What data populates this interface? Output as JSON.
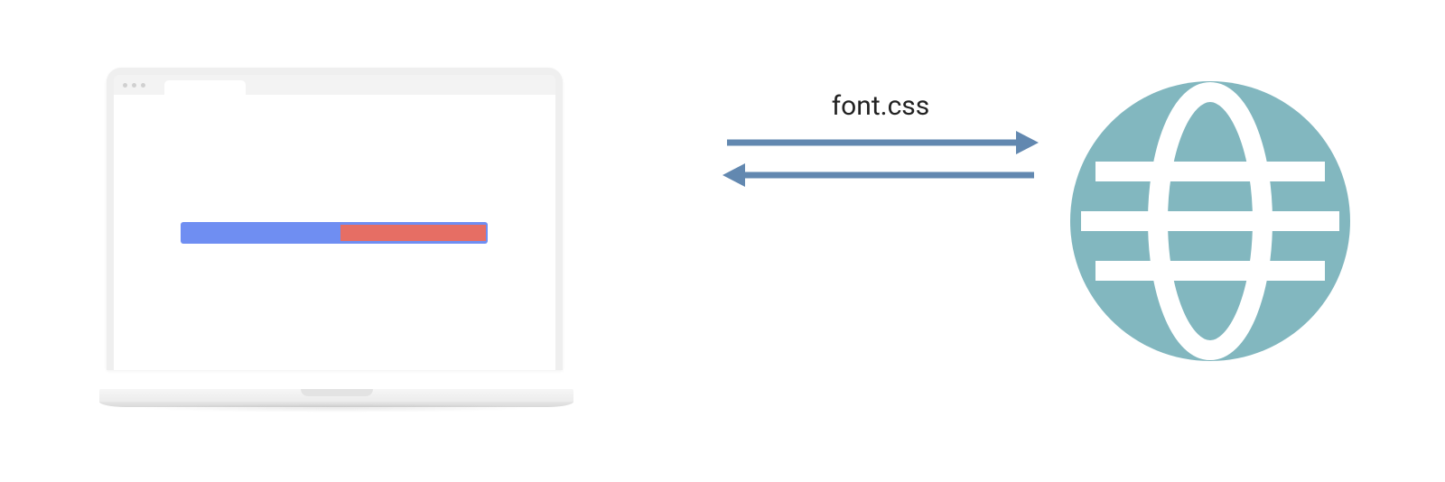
{
  "diagram": {
    "arrow_label": "font.css",
    "colors": {
      "arrow": "#6288b0",
      "globe": "#82b7bf",
      "progress_bg": "#6f8ef2",
      "progress_fill": "#e66e64"
    },
    "icons": {
      "laptop": "laptop-browser-icon",
      "globe": "globe-icon",
      "arrow_right": "arrow-right-icon",
      "arrow_left": "arrow-left-icon"
    }
  }
}
